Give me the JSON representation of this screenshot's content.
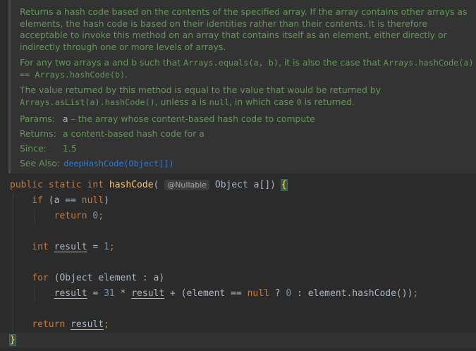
{
  "doc": {
    "p1": "Returns a hash code based on the contents of the specified array. If the array contains other arrays as elements, the hash code is based on their identities rather than their contents. It is therefore acceptable to invoke this method on an array that contains itself as an element, either directly or indirectly through one or more levels of arrays.",
    "p2_a": "For any two arrays a and b such that ",
    "p2_code1": "Arrays.equals(a, b)",
    "p2_b": ", it is also the case that ",
    "p2_code2": "Arrays.hashCode(a) == Arrays.hashCode(b)",
    "p2_c": ".",
    "p3_a": "The value returned by this method is equal to the value that would be returned by ",
    "p3_code1": "Arrays.asList(a).hashCode()",
    "p3_b": ", unless a is ",
    "p3_code2": "null",
    "p3_c": ", in which case ",
    "p3_code3": "0",
    "p3_d": " is returned.",
    "params_label": "Params:",
    "params_name": "a",
    "params_desc": " – the array whose content-based hash code to compute",
    "returns_label": "Returns:",
    "returns_desc": "a content-based hash code for a",
    "since_label": "Since:",
    "since_value": "1.5",
    "see_label": "See Also:",
    "see_link": "deepHashCode(Object[])"
  },
  "code": {
    "kw_public": "public",
    "kw_static": "static",
    "kw_int": "int",
    "method_name": "hashCode",
    "paren_open": "(",
    "annotation": "@Nullable",
    "param": " Object a[]) ",
    "brace_open": "{",
    "kw_if": "if",
    "if_cond_a": " (a == ",
    "kw_null": "null",
    "if_cond_b": ")",
    "kw_return": "return",
    "zero": "0",
    "semi": ";",
    "var_result": "result",
    "assign": " = ",
    "one": "1",
    "kw_for": "for",
    "for_head": " (Object element : a)",
    "thirty_one": "31",
    "mul": " * ",
    "plus_open": " + (element == ",
    "ternary_q": " ? ",
    "ternary_colon": " : element.hashCode())",
    "brace_close": "}"
  },
  "colors": {
    "background": "#2b2b2b",
    "doc_background": "#333333",
    "doc_text": "#629755",
    "keyword": "#cc7832",
    "number": "#6897bb",
    "method": "#ffc66d",
    "link": "#287bde"
  }
}
